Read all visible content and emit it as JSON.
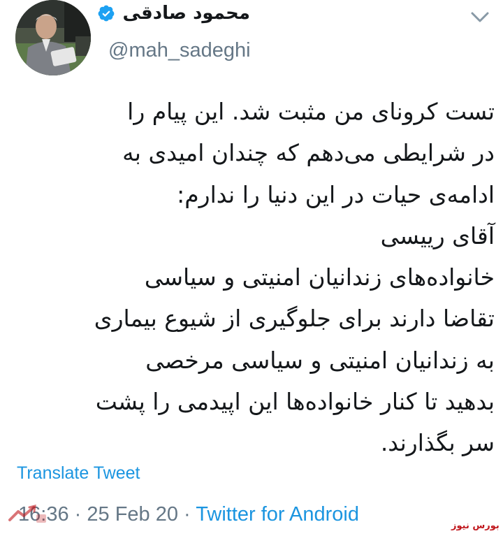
{
  "author": {
    "display_name": "محمود صادقی",
    "handle": "@mah_sadeghi",
    "verified": true
  },
  "icons": {
    "verified": "verified-badge-icon",
    "menu": "chevron-down-icon"
  },
  "tweet": {
    "lines": [
      "تست کرونای من مثبت شد. این پیام را",
      "در شرایطی می‌دهم که چندان امیدی به",
      "ادامه‌ی حیات در این دنیا را ندارم:",
      "آقای رییسی",
      "خانواده‌های زندانیان امنیتی و سیاسی",
      "تقاضا دارند برای جلوگیری از شیوع بیماری",
      "به زندانیان امنیتی و سیاسی مرخصی",
      "بدهید تا کنار خانواده‌ها این اپیدمی را پشت",
      "سر بگذارند."
    ],
    "translate_label": "Translate Tweet",
    "time": "16:36",
    "date": "25 Feb 20",
    "separator": "·",
    "source": "Twitter for Android"
  },
  "watermark": {
    "text": "بورس نیوز"
  },
  "colors": {
    "link": "#1b95e0",
    "secondary": "#657786",
    "text": "#14171a",
    "watermark": "#c0171d"
  }
}
